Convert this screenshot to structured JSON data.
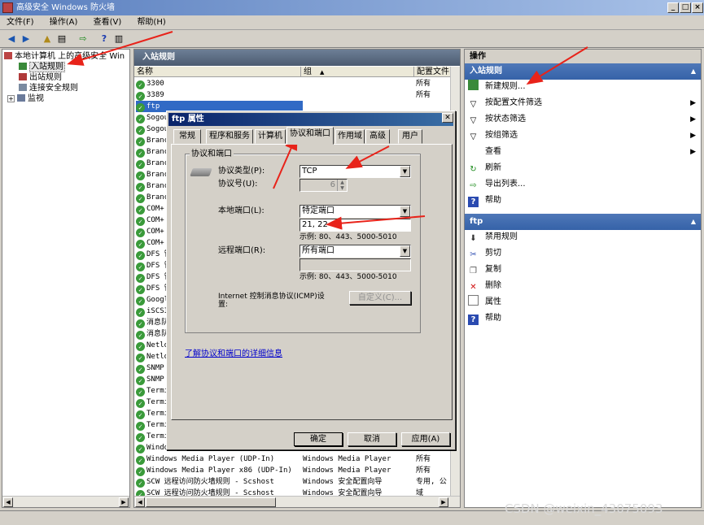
{
  "window": {
    "title": "高级安全 Windows 防火墙"
  },
  "menu": [
    "文件(F)",
    "操作(A)",
    "查看(V)",
    "帮助(H)"
  ],
  "tree": {
    "root": "本地计算机 上的高级安全 Win",
    "items": [
      "入站规则",
      "出站规则",
      "连接安全规则",
      "监视"
    ]
  },
  "center": {
    "title": "入站规则",
    "columns": [
      "名称",
      "组",
      "配置文件"
    ],
    "rows": [
      {
        "name": "3300",
        "group": "",
        "profile": "所有"
      },
      {
        "name": "3389",
        "group": "",
        "profile": "所有"
      },
      {
        "name": "ftp",
        "group": "",
        "profile": "所有"
      },
      {
        "name": "Sogou",
        "group": "",
        "profile": ""
      },
      {
        "name": "Sogou",
        "group": "",
        "profile": ""
      },
      {
        "name": "Branc",
        "group": "",
        "profile": ""
      },
      {
        "name": "Branc",
        "group": "",
        "profile": ""
      },
      {
        "name": "Branc",
        "group": "",
        "profile": ""
      },
      {
        "name": "Branc",
        "group": "",
        "profile": ""
      },
      {
        "name": "Branc",
        "group": "",
        "profile": ""
      },
      {
        "name": "Branc",
        "group": "",
        "profile": ""
      },
      {
        "name": "COM+",
        "group": "",
        "profile": ""
      },
      {
        "name": "COM+",
        "group": "",
        "profile": ""
      },
      {
        "name": "COM+",
        "group": "",
        "profile": ""
      },
      {
        "name": "COM+",
        "group": "",
        "profile": ""
      },
      {
        "name": "DFS 管",
        "group": "",
        "profile": ""
      },
      {
        "name": "DFS 管",
        "group": "",
        "profile": ""
      },
      {
        "name": "DFS 管",
        "group": "",
        "profile": ""
      },
      {
        "name": "DFS 管",
        "group": "",
        "profile": ""
      },
      {
        "name": "Googl",
        "group": "",
        "profile": ""
      },
      {
        "name": "iSCSI",
        "group": "",
        "profile": ""
      },
      {
        "name": "消息队",
        "group": "",
        "profile": ""
      },
      {
        "name": "消息队",
        "group": "",
        "profile": ""
      },
      {
        "name": "Netlo",
        "group": "",
        "profile": ""
      },
      {
        "name": "Netlo",
        "group": "",
        "profile": ""
      },
      {
        "name": "SNMP",
        "group": "",
        "profile": ""
      },
      {
        "name": "SNMP",
        "group": "",
        "profile": ""
      },
      {
        "name": "Termi",
        "group": "",
        "profile": ""
      },
      {
        "name": "Termi",
        "group": "",
        "profile": ""
      },
      {
        "name": "Termi",
        "group": "",
        "profile": ""
      },
      {
        "name": "Termi",
        "group": "",
        "profile": ""
      },
      {
        "name": "Termi",
        "group": "",
        "profile": ""
      },
      {
        "name": "Windo",
        "group": "",
        "profile": ""
      },
      {
        "name": "Windows Media Player (UDP-In)",
        "group": "Windows Media Player",
        "profile": "所有"
      },
      {
        "name": "Windows Media Player x86 (UDP-In)",
        "group": "Windows Media Player",
        "profile": "所有"
      },
      {
        "name": "SCW 远程访问防火墙规则 - Scshost",
        "group": "Windows 安全配置向导",
        "profile": "专用, 公"
      },
      {
        "name": "SCW 远程访问防火墙规则 - Scshost",
        "group": "Windows 安全配置向导",
        "profile": "域"
      }
    ]
  },
  "actions": {
    "header": "操作",
    "section1": "入站规则",
    "items1": [
      "新建规则...",
      "按配置文件筛选",
      "按状态筛选",
      "按组筛选",
      "查看",
      "刷新",
      "导出列表...",
      "帮助"
    ],
    "section2": "ftp",
    "items2": [
      "禁用规则",
      "剪切",
      "复制",
      "删除",
      "属性",
      "帮助"
    ]
  },
  "dialog": {
    "title": "ftp 属性",
    "close": "✕",
    "tabs": [
      "常规",
      "程序和服务",
      "计算机",
      "协议和端口",
      "作用域",
      "高级",
      "用户"
    ],
    "group_label": "协议和端口",
    "protocol_type_label": "协议类型(P):",
    "protocol_type_value": "TCP",
    "protocol_number_label": "协议号(U):",
    "protocol_number_value": "6",
    "local_port_label": "本地端口(L):",
    "local_port_select": "特定端口",
    "local_port_value": "21, 22",
    "example1": "示例: 80、443、5000-5010",
    "remote_port_label": "远程端口(R):",
    "remote_port_select": "所有端口",
    "remote_port_value": "",
    "example2": "示例: 80、443、5000-5010",
    "icmp_label_1": "Internet 控制消息协议(ICMP)设",
    "icmp_label_2": "置:",
    "customize_button": "自定义(C)...",
    "link": "了解协议和端口的详细信息",
    "ok": "确定",
    "cancel": "取消",
    "apply": "应用(A)"
  },
  "watermark": "CSDN @weixin_43075093",
  "colors": {
    "arrow": "#e8231a",
    "selected": "#316ac5",
    "check_green": "#3a9a3a"
  }
}
